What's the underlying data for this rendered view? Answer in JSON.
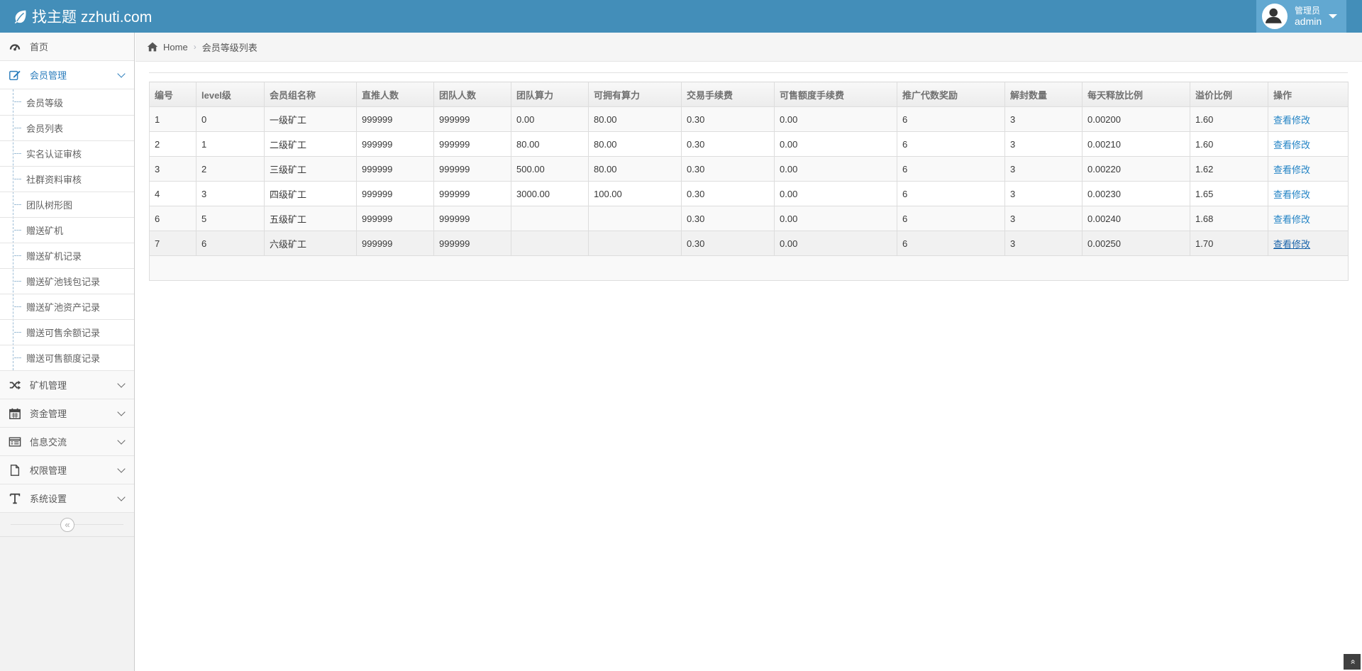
{
  "header": {
    "brand": "找主题 zzhuti.com",
    "user_role": "管理员",
    "user_name": "admin"
  },
  "sidebar": {
    "items": [
      {
        "label": "首页",
        "icon": "dashboard-icon"
      },
      {
        "label": "会员管理",
        "icon": "edit-icon",
        "expanded": true,
        "children": [
          "会员等级",
          "会员列表",
          "实名认证审核",
          "社群资料审核",
          "团队树形图",
          "赠送矿机",
          "赠送矿机记录",
          "赠送矿池钱包记录",
          "赠送矿池资产记录",
          "赠送可售余额记录",
          "赠送可售额度记录"
        ]
      },
      {
        "label": "矿机管理",
        "icon": "shuffle-icon"
      },
      {
        "label": "资金管理",
        "icon": "calendar-icon"
      },
      {
        "label": "信息交流",
        "icon": "list-icon"
      },
      {
        "label": "权限管理",
        "icon": "file-icon"
      },
      {
        "label": "系统设置",
        "icon": "text-icon"
      }
    ],
    "collapse_glyph": "«"
  },
  "breadcrumb": {
    "home": "Home",
    "current": "会员等级列表"
  },
  "table": {
    "headers": [
      "编号",
      "level级",
      "会员组名称",
      "直推人数",
      "团队人数",
      "团队算力",
      "可拥有算力",
      "交易手续费",
      "可售额度手续费",
      "推广代数奖励",
      "解封数量",
      "每天释放比例",
      "溢价比例",
      "操作"
    ],
    "rows": [
      [
        "1",
        "0",
        "一级矿工",
        "999999",
        "999999",
        "0.00",
        "80.00",
        "0.30",
        "0.00",
        "6",
        "3",
        "0.00200",
        "1.60",
        "查看修改"
      ],
      [
        "2",
        "1",
        "二级矿工",
        "999999",
        "999999",
        "80.00",
        "80.00",
        "0.30",
        "0.00",
        "6",
        "3",
        "0.00210",
        "1.60",
        "查看修改"
      ],
      [
        "3",
        "2",
        "三级矿工",
        "999999",
        "999999",
        "500.00",
        "80.00",
        "0.30",
        "0.00",
        "6",
        "3",
        "0.00220",
        "1.62",
        "查看修改"
      ],
      [
        "4",
        "3",
        "四级矿工",
        "999999",
        "999999",
        "3000.00",
        "100.00",
        "0.30",
        "0.00",
        "6",
        "3",
        "0.00230",
        "1.65",
        "查看修改"
      ],
      [
        "6",
        "5",
        "五级矿工",
        "999999",
        "999999",
        "",
        "",
        "0.30",
        "0.00",
        "6",
        "3",
        "0.00240",
        "1.68",
        "查看修改"
      ],
      [
        "7",
        "6",
        "六级矿工",
        "999999",
        "999999",
        "",
        "",
        "0.30",
        "0.00",
        "6",
        "3",
        "0.00250",
        "1.70",
        "查看修改"
      ]
    ]
  },
  "scroll_top_glyph": "»"
}
